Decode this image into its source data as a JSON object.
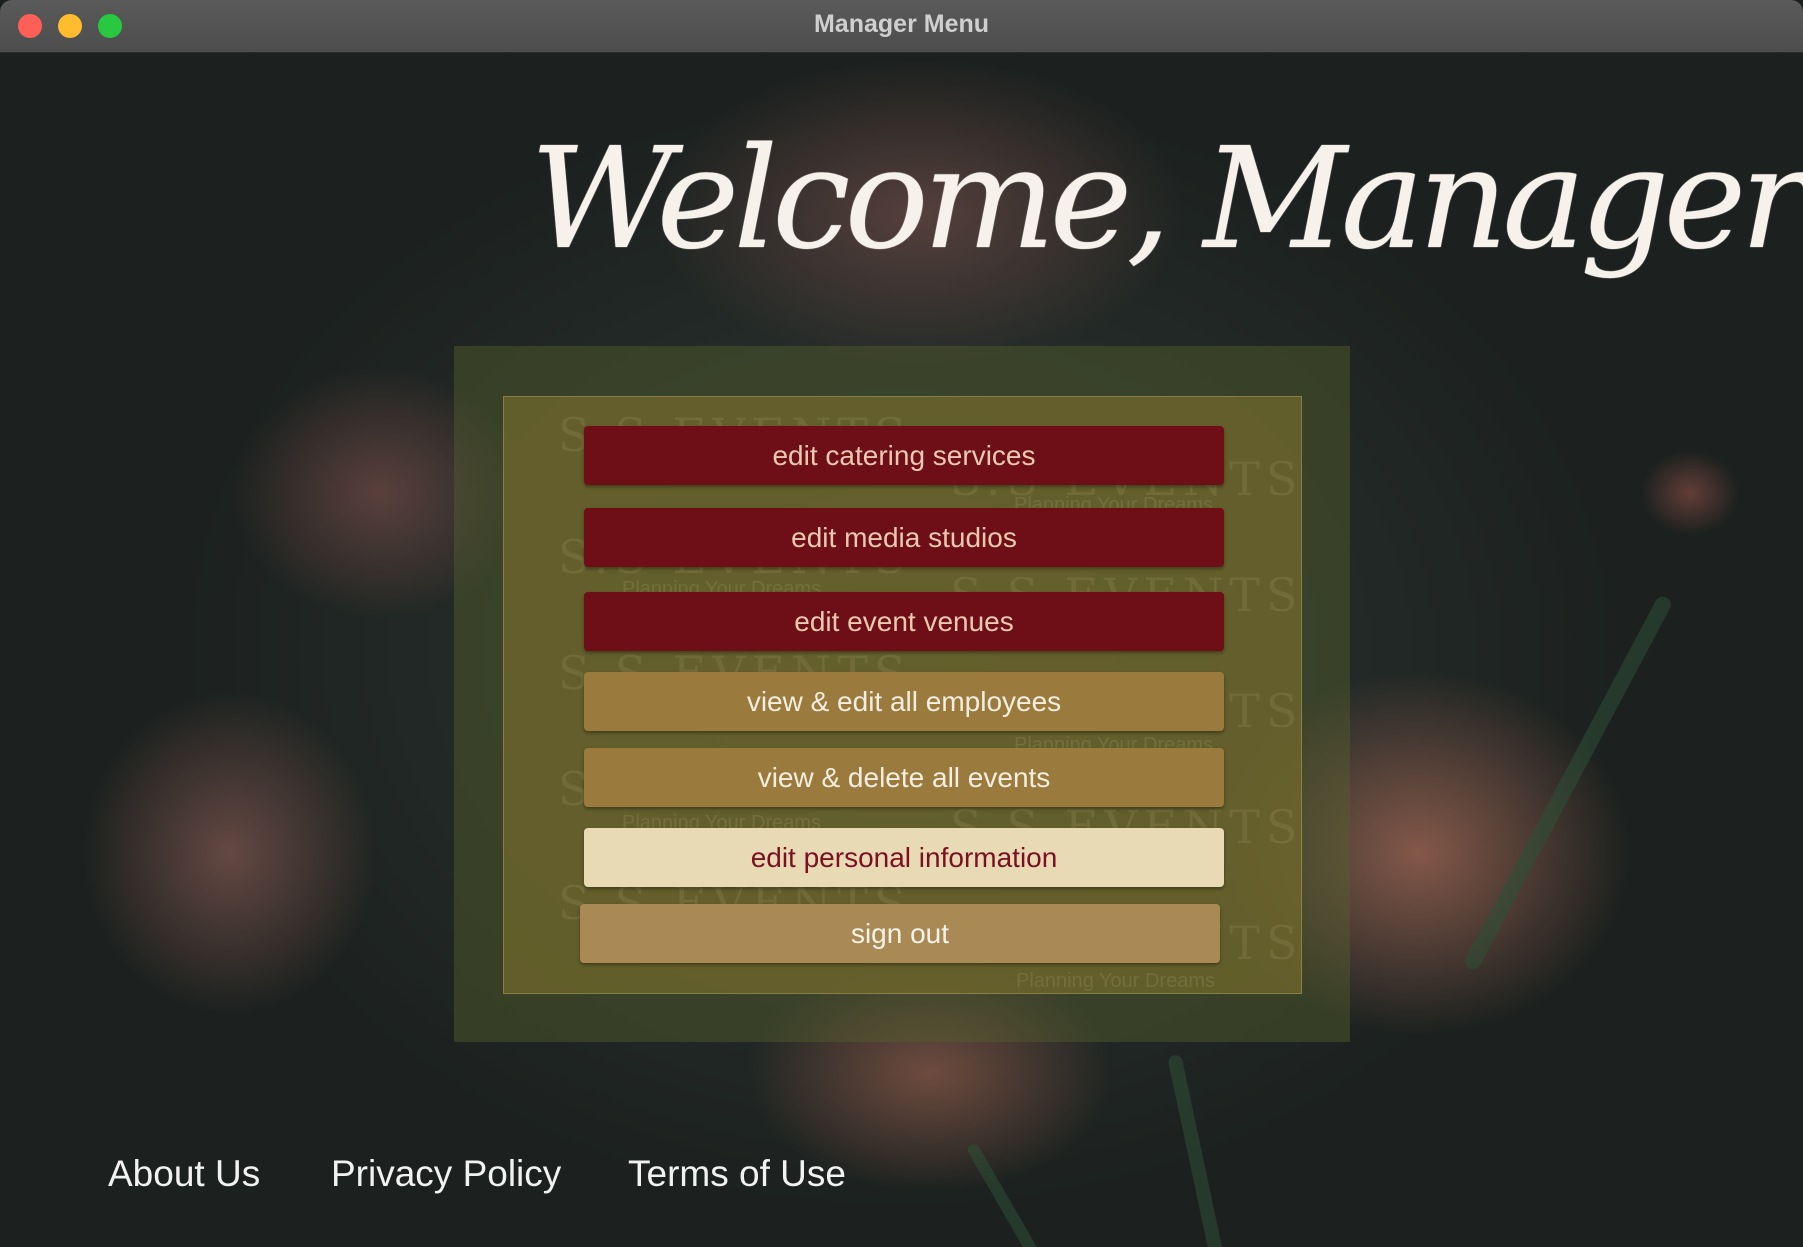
{
  "window": {
    "title": "Manager Menu"
  },
  "header": {
    "welcome_text": "Welcome, Manager"
  },
  "watermark": {
    "brand": "S.S EVENTS",
    "tagline": "Planning Your Dreams"
  },
  "menu": {
    "edit_catering": "edit catering services",
    "edit_media": "edit media studios",
    "edit_venues": "edit event venues",
    "employees": "view & edit all employees",
    "events": "view & delete all events",
    "personal_info": "edit personal information",
    "sign_out": "sign out"
  },
  "footer": {
    "about": "About Us",
    "privacy": "Privacy Policy",
    "terms": "Terms of Use"
  },
  "colors": {
    "button_red": "#6e0e17",
    "button_gold": "#9a7a3d",
    "button_cream": "#e8dab4",
    "button_tan": "#a98a55"
  }
}
